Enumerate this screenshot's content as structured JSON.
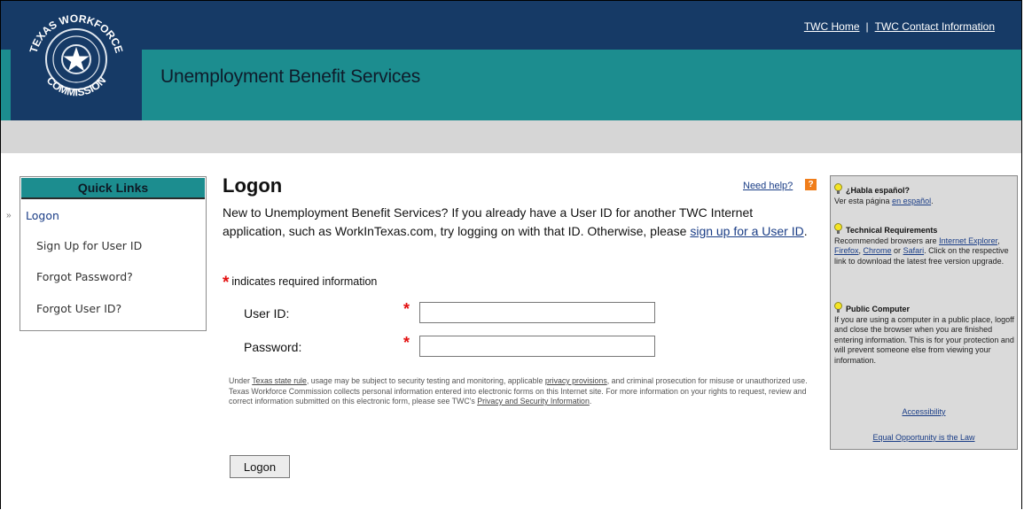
{
  "header": {
    "logo_text_top": "TEXAS WORKFORCE",
    "logo_text_bottom": "COMMISSION",
    "links": [
      "TWC Home",
      "TWC Contact Information"
    ],
    "separator": "|",
    "app_title": "Unemployment Benefit Services"
  },
  "quick_links": {
    "title": "Quick Links",
    "items": [
      "Logon",
      "Sign Up for User ID",
      "Forgot Password?",
      "Forgot User ID?"
    ],
    "active_index": 0
  },
  "main": {
    "title": "Logon",
    "help_label": "Need help?",
    "help_icon": "?",
    "intro_text": "New to Unemployment Benefit Services? If you already have a User ID for another TWC Internet application, such as WorkInTexas.com, try logging on with that ID. Otherwise, please ",
    "intro_link": "sign up for a User ID",
    "intro_end": ".",
    "required_star": "*",
    "required_note": "indicates required information",
    "fields": [
      {
        "label": "User ID:",
        "value": "",
        "placeholder": ""
      },
      {
        "label": "Password:",
        "value": "",
        "placeholder": ""
      }
    ],
    "legal": {
      "p1": "Under ",
      "link1": "Texas state rule",
      "p2": ", usage may be subject to security testing and monitoring, applicable ",
      "link2": "privacy provisions",
      "p3": ", and criminal prosecution for misuse or unauthorized use. Texas Workforce Commission collects personal information entered into electronic forms on this Internet site. For more information on your rights to request, review and correct information submitted on this electronic form, please see TWC's ",
      "link3": "Privacy and Security Information",
      "p4": "."
    },
    "submit_label": "Logon"
  },
  "sidebar": {
    "espanol_head": "¿Habla español?",
    "espanol_text": "Ver esta página ",
    "espanol_link": "en español",
    "espanol_end": ".",
    "tech_head": "Technical Requirements",
    "tech_text1": "Recommended browsers are ",
    "tech_link_ie": "Internet Explorer",
    "tech_comma1": ", ",
    "tech_link_ff": "Firefox",
    "tech_comma2": ", ",
    "tech_link_chrome": "Chrome",
    "tech_or": " or ",
    "tech_link_safari": "Safari",
    "tech_text2": ". Click on the respective link to download the latest free version upgrade.",
    "public_head": "Public Computer",
    "public_text": "If you are using a computer in a public place, logoff and close the browser when you are finished entering information. This is for your protection and will prevent someone else from viewing your information.",
    "accessibility_link": "Accessibility",
    "eeo_link": "Equal Opportunity is the Law"
  },
  "colors": {
    "navy": "#163a66",
    "teal": "#1c8d8f",
    "grey_bar": "#d6d6d6",
    "required_red": "#e30f0f",
    "help_orange": "#f07d1a"
  }
}
